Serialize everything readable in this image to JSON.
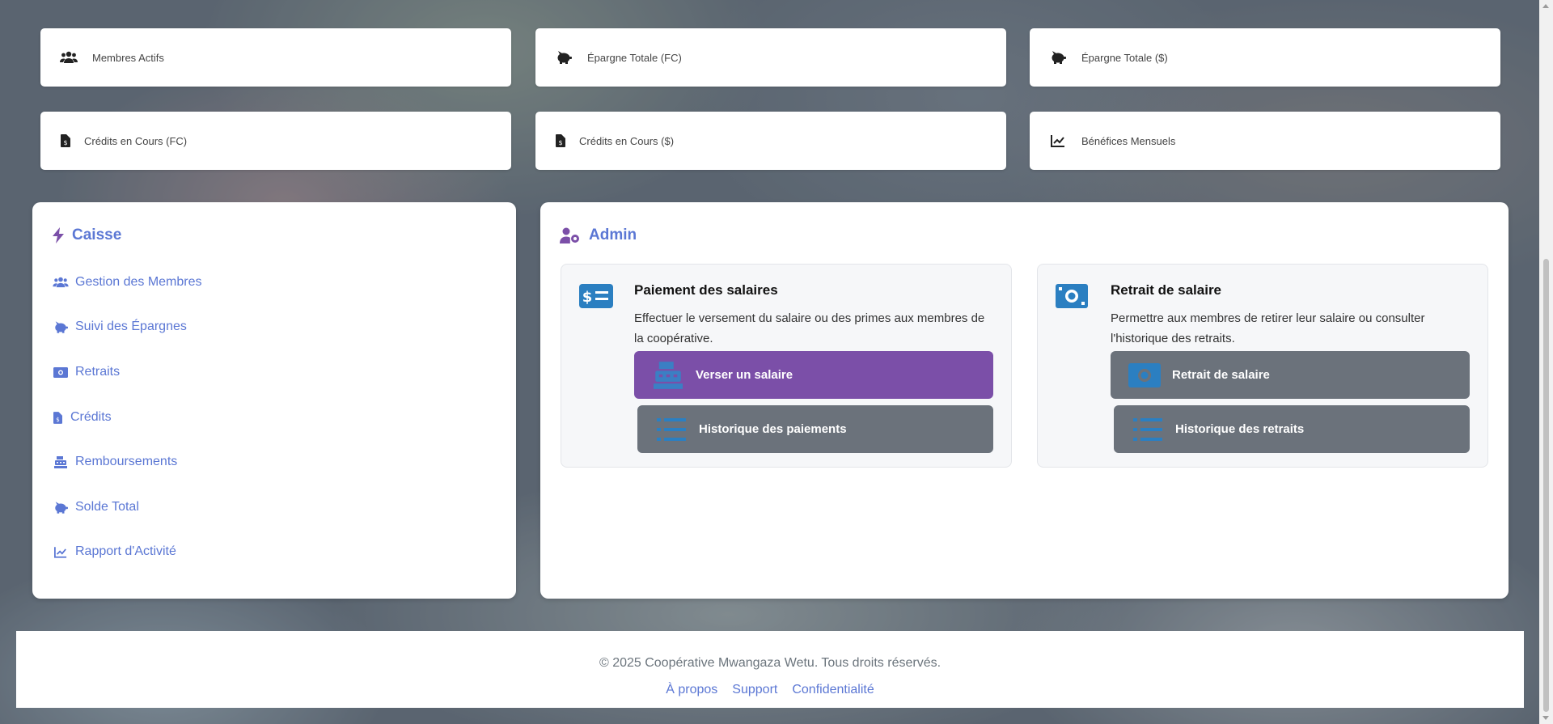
{
  "stats": [
    {
      "label": "Membres Actifs",
      "icon": "users-icon"
    },
    {
      "label": "Épargne Totale (FC)",
      "icon": "piggy-bank-icon"
    },
    {
      "label": "Épargne Totale ($)",
      "icon": "piggy-bank-icon"
    },
    {
      "label": "Crédits en Cours (FC)",
      "icon": "invoice-dollar-icon"
    },
    {
      "label": "Crédits en Cours ($)",
      "icon": "invoice-dollar-icon"
    },
    {
      "label": "Bénéfices Mensuels",
      "icon": "chart-line-icon"
    }
  ],
  "caisse": {
    "title": "Caisse",
    "items": [
      {
        "label": "Gestion des Membres",
        "icon": "users-icon"
      },
      {
        "label": "Suivi des Épargnes",
        "icon": "piggy-bank-icon"
      },
      {
        "label": "Retraits",
        "icon": "money-bill-icon"
      },
      {
        "label": "Crédits",
        "icon": "invoice-dollar-icon"
      },
      {
        "label": "Remboursements",
        "icon": "cash-register-icon"
      },
      {
        "label": "Solde Total",
        "icon": "piggy-bank-icon"
      },
      {
        "label": "Rapport d'Activité",
        "icon": "chart-line-icon"
      }
    ]
  },
  "admin": {
    "title": "Admin",
    "paiement": {
      "title": "Paiement des salaires",
      "description": "Effectuer le versement du salaire ou des primes aux membres de la coopérative.",
      "primary_button": "Verser un salaire",
      "secondary_button": "Historique des paiements"
    },
    "retrait": {
      "title": "Retrait de salaire",
      "description": "Permettre aux membres de retirer leur salaire ou consulter l'historique des retraits.",
      "primary_button": "Retrait de salaire",
      "secondary_button": "Historique des retraits"
    }
  },
  "footer": {
    "copyright": "© 2025 Coopérative Mwangaza Wetu. Tous droits réservés.",
    "links": [
      "À propos",
      "Support",
      "Confidentialité"
    ]
  },
  "colors": {
    "accent": "#5b77d4",
    "purple": "#7b4fa8",
    "gray_button": "#6b727b",
    "icon_blue": "#2b7fc1"
  }
}
